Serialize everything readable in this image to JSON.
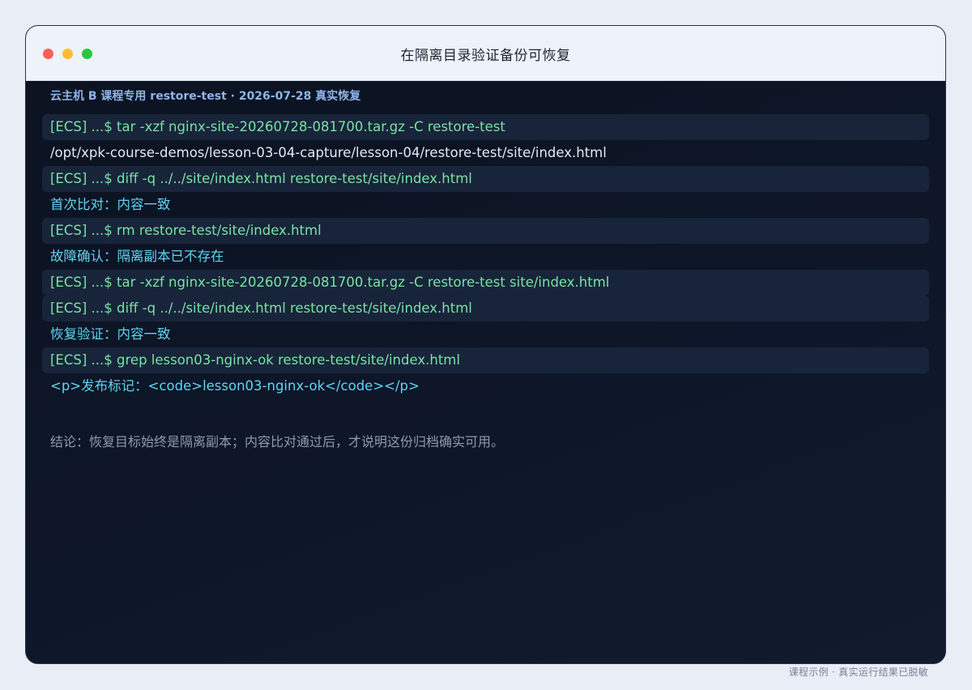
{
  "window": {
    "title": "在隔离目录验证备份可恢复"
  },
  "header": {
    "subtitle": "云主机 B 课程专用 restore-test · 2026-07-28 真实恢复"
  },
  "terminal": {
    "lines": [
      {
        "kind": "cmd",
        "text": "[ECS] ...$ tar -xzf nginx-site-20260728-081700.tar.gz -C restore-test"
      },
      {
        "kind": "out",
        "text": "/opt/xpk-course-demos/lesson-03-04-capture/lesson-04/restore-test/site/index.html"
      },
      {
        "kind": "cmd",
        "text": "[ECS] ...$ diff -q ../../site/index.html restore-test/site/index.html"
      },
      {
        "kind": "ok",
        "text": "首次比对：内容一致"
      },
      {
        "kind": "cmd",
        "text": "[ECS] ...$ rm restore-test/site/index.html"
      },
      {
        "kind": "ok",
        "text": "故障确认：隔离副本已不存在"
      },
      {
        "kind": "cmd",
        "text": "[ECS] ...$ tar -xzf nginx-site-20260728-081700.tar.gz -C restore-test site/index.html"
      },
      {
        "kind": "cmd",
        "text": "[ECS] ...$ diff -q ../../site/index.html restore-test/site/index.html"
      },
      {
        "kind": "ok",
        "text": "恢复验证：内容一致"
      },
      {
        "kind": "cmd",
        "text": "[ECS] ...$ grep lesson03-nginx-ok restore-test/site/index.html"
      },
      {
        "kind": "ok",
        "text": "<p>发布标记：<code>lesson03-nginx-ok</code></p>"
      }
    ],
    "conclusion": "结论：恢复目标始终是隔离副本；内容比对通过后，才说明这份归档确实可用。"
  },
  "footer": {
    "note": "课程示例 · 真实运行结果已脱敏"
  },
  "colors": {
    "command": "#79e2a4",
    "output": "#e3e8f1",
    "status": "#5fd4f2",
    "subtitle": "#8fb4e8",
    "conclusion": "#8e9ab0",
    "traffic_red": "#fe5f57",
    "traffic_yellow": "#febc2e",
    "traffic_green": "#28c840"
  }
}
